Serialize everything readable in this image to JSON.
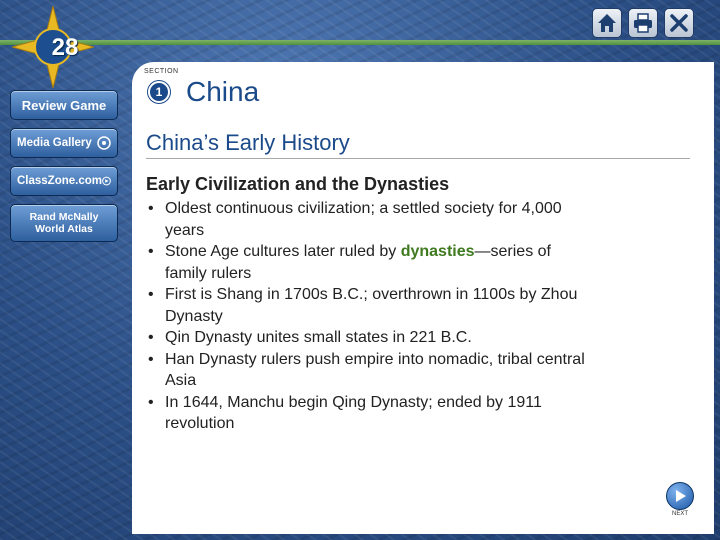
{
  "chapter": {
    "number": "28"
  },
  "sidebar": {
    "items": [
      {
        "label": "Review Game"
      },
      {
        "label": "Media Gallery"
      },
      {
        "label": "ClassZone.com"
      },
      {
        "label": "Rand McNally World Atlas"
      }
    ]
  },
  "top_icons": [
    "home-icon",
    "print-icon",
    "close-icon"
  ],
  "section": {
    "label": "SECTION",
    "number": "1",
    "title": "China"
  },
  "slide": {
    "subtitle": "China’s Early History",
    "heading": "Early Civilization and the Dynasties",
    "bullets": [
      "Oldest continuous civilization; a settled society for 4,000 years",
      {
        "before": "Stone Age cultures later ruled by ",
        "highlight": "dynasties",
        "after": "—series of family rulers"
      },
      "First is Shang in 1700s B.C.; overthrown in 1100s by Zhou Dynasty",
      "Qin Dynasty unites small states in 221 B.C.",
      "Han Dynasty rulers push empire into nomadic, tribal central Asia",
      "In 1644, Manchu begin Qing Dynasty; ended by 1911 revolution"
    ]
  },
  "nav": {
    "next_label": "NEXT"
  },
  "colors": {
    "title_blue": "#1b4a8a",
    "highlight_green": "#3f7a1f",
    "background_blue": "#2a4f86"
  }
}
